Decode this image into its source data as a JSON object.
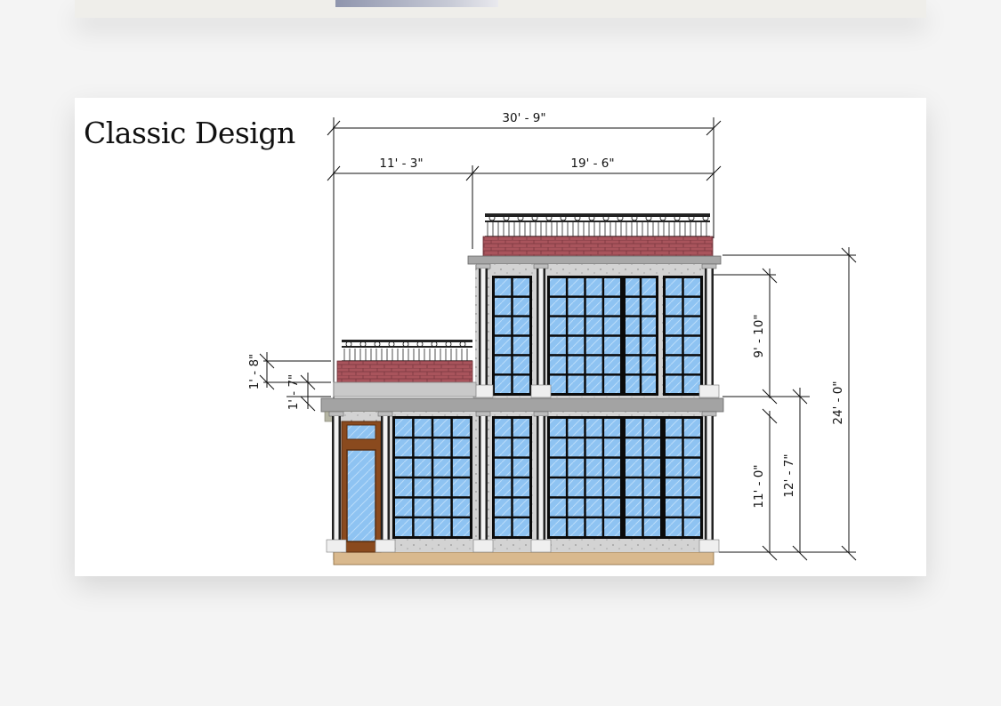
{
  "top_card": {
    "thumbnail": "elevation-thumbnail"
  },
  "card": {
    "title": "Classic Design",
    "dimensions": {
      "overall_width": "30' - 9\"",
      "left_width": "11' - 3\"",
      "right_width": "19' - 6\"",
      "upper_floor_height": "9' - 10\"",
      "total_height": "24' - 0\"",
      "ground_floor_height": "11' - 0\"",
      "ground_to_slab": "12' - 7\"",
      "parapet_height": "1' - 8\"",
      "slab_thickness": "1' - 7\""
    }
  },
  "colors": {
    "glass": "#8ec3f2",
    "mullion": "#0b0b0b",
    "brick": "#a9545c",
    "stone": "#c9c9c9",
    "plinth": "#d9b98e",
    "door": "#8a4a1e"
  }
}
